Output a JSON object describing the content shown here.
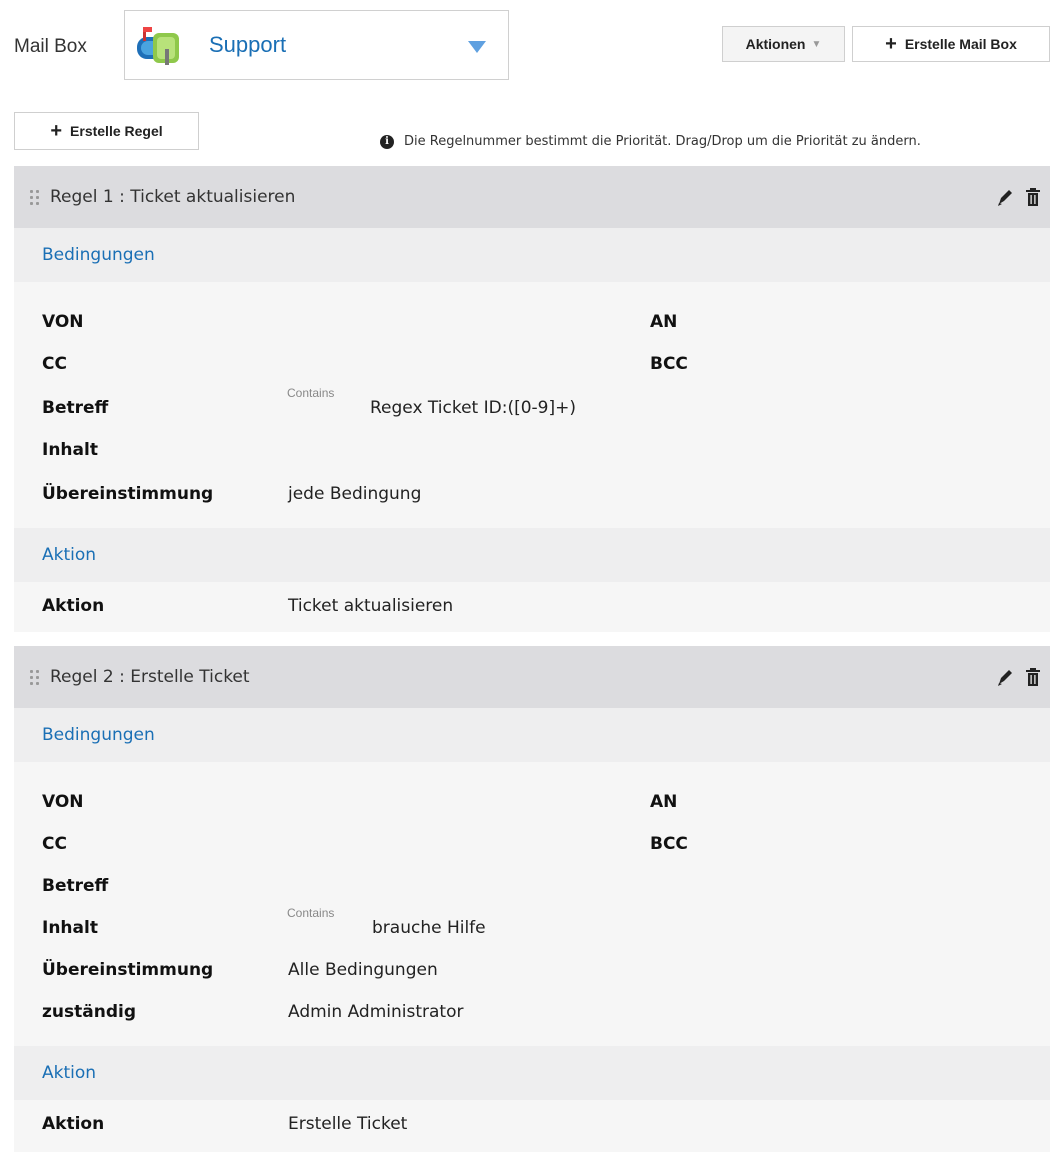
{
  "mailbox": {
    "label": "Mail Box",
    "selected": "Support",
    "icon": "mailbox-icon"
  },
  "toolbar": {
    "actions_label": "Aktionen",
    "create_mailbox_label": "Erstelle Mail Box",
    "create_rule_label": "Erstelle Regel",
    "hint": "Die Regelnummer bestimmt die Priorität. Drag/Drop um die Priorität zu ändern."
  },
  "labels": {
    "conditions": "Bedingungen",
    "action_section": "Aktion",
    "from": "VON",
    "to": "AN",
    "cc": "CC",
    "bcc": "BCC",
    "subject": "Betreff",
    "content": "Inhalt",
    "match": "Übereinstimmung",
    "assignee": "zuständig",
    "action": "Aktion"
  },
  "rules": [
    {
      "title": "Regel 1 : Ticket aktualisieren",
      "subject_op": "Contains",
      "subject_val": "Regex Ticket ID:([0-9]+)",
      "match": "jede Bedingung",
      "action": "Ticket aktualisieren"
    },
    {
      "title": "Regel 2 : Erstelle Ticket",
      "content_op": "Contains",
      "content_val": "brauche Hilfe",
      "match": "Alle Bedingungen",
      "assignee": "Admin Administrator",
      "action": "Erstelle Ticket"
    }
  ],
  "colors": {
    "accent": "#1a6fb5",
    "rule_header_bg": "#dcdcdf",
    "section_bg": "#eeeeef"
  }
}
